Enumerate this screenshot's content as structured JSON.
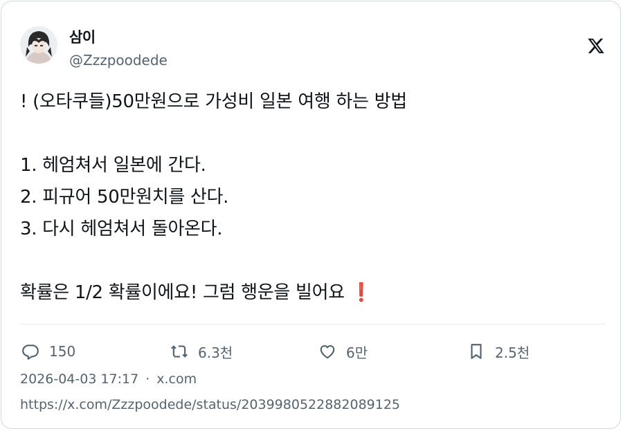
{
  "user": {
    "display_name": "삼이",
    "handle": "@Zzzpoodede"
  },
  "brand": {
    "logo": "x-logo-icon"
  },
  "tweet": {
    "text": "! (오타쿠들)50만원으로 가성비 일본 여행 하는 방법\n\n1. 헤엄쳐서 일본에 간다.\n2. 피규어 50만원치를 산다.\n3. 다시 헤엄쳐서 돌아온다.\n\n확률은 1/2 확률이에요! 그럼 행운을 빌어요 ",
    "trailing_emoji": "❗"
  },
  "actions": {
    "reply": {
      "icon": "reply-icon",
      "count": "150"
    },
    "retweet": {
      "icon": "retweet-icon",
      "count": "6.3천"
    },
    "like": {
      "icon": "heart-icon",
      "count": "6만"
    },
    "bookmark": {
      "icon": "bookmark-icon",
      "count": "2.5천"
    }
  },
  "meta": {
    "timestamp": "2026-04-03 17:17",
    "separator": "·",
    "source": "x.com"
  },
  "url": "https://x.com/Zzzpoodede/status/2039980522882089125",
  "colors": {
    "text_primary": "#0f1419",
    "text_secondary": "#536471",
    "border": "#cfd9de",
    "accent_red": "#e0245e"
  }
}
